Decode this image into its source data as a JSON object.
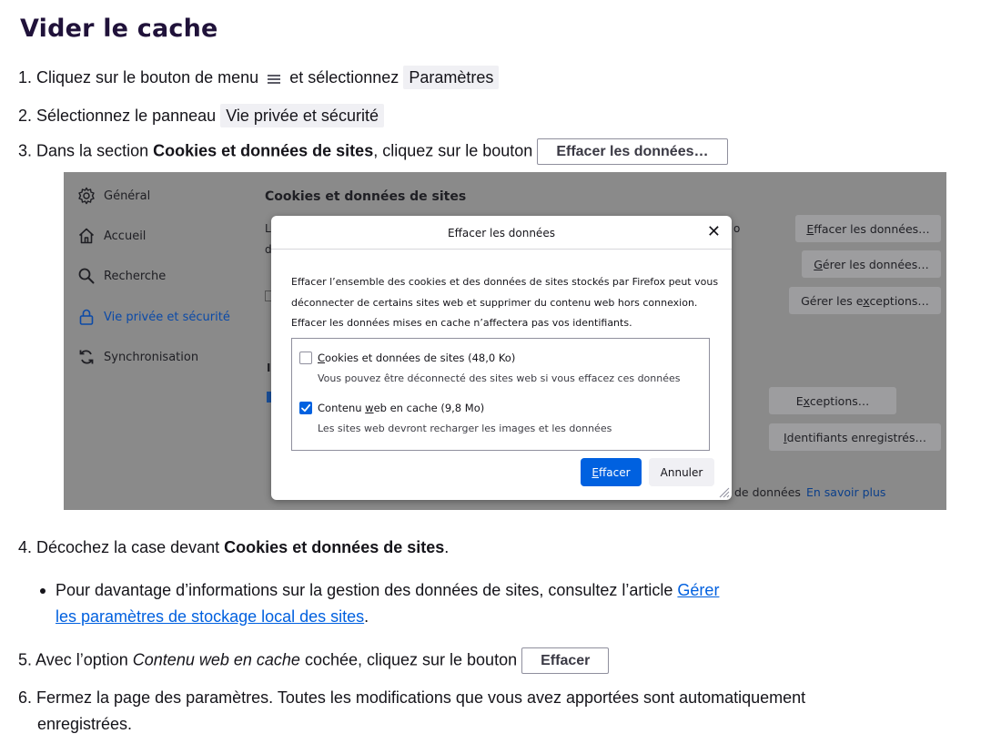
{
  "title": "Vider le cache",
  "steps": {
    "s1": {
      "num": "1.",
      "pre": "Cliquez sur le bouton de menu",
      "mid": "et sélectionnez",
      "chip": "Paramètres"
    },
    "s2": {
      "num": "2.",
      "pre": "Sélectionnez le panneau",
      "chip": "Vie privée et sécurité"
    },
    "s3": {
      "num": "3.",
      "pre": "Dans la section",
      "bold": "Cookies et données de sites",
      "post": ", cliquez sur le bouton",
      "btn": "Effacer les données…"
    },
    "s4": {
      "num": "4.",
      "pre": "Décochez la case devant",
      "bold": "Cookies et données de sites",
      "post": "."
    },
    "s5": {
      "num": "5.",
      "pre": "Avec l’option",
      "italic": "Contenu web en cache",
      "post": "cochée, cliquez sur le bouton",
      "btn": "Effacer"
    },
    "s6": {
      "num": "6.",
      "line1": "Fermez la page des paramètres. Toutes les modifications que vous avez apportées sont automatiquement",
      "line2": "enregistrées."
    }
  },
  "bullet": {
    "pre": "Pour davantage d’informations sur la gestion des données de sites, consultez l’article",
    "link1": "Gérer",
    "link2": "les paramètres de stockage local des sites",
    "post": "."
  },
  "screenshot": {
    "nav": [
      {
        "label": "Général",
        "icon": "gear-icon"
      },
      {
        "label": "Accueil",
        "icon": "home-icon"
      },
      {
        "label": "Recherche",
        "icon": "search-icon"
      },
      {
        "label": "Vie privée et sécurité",
        "icon": "lock-icon"
      },
      {
        "label": "Synchronisation",
        "icon": "sync-icon"
      }
    ],
    "heading": "Cookies et données de sites",
    "frag_l": "L",
    "frag_d": "d",
    "frag_o": "o",
    "frag_i": "I",
    "buttons": {
      "clear": {
        "ul": "E",
        "rest": "ffacer les données…"
      },
      "manage": {
        "ul": "G",
        "rest": "érer les données…"
      },
      "exceptions": {
        "pre": "Gérer les e",
        "ul": "x",
        "rest": "ceptions…"
      },
      "exc2": {
        "pre": "E",
        "ul": "x",
        "rest": "ceptions…"
      },
      "logins": {
        "ul": "I",
        "rest": "dentifiants enregistrés…"
      }
    },
    "footer_text": "de données",
    "footer_link": "En savoir plus",
    "dialog": {
      "title": "Effacer les données",
      "close": "✕",
      "text1": "Effacer l’ensemble des cookies et des données de sites stockés par Firefox peut vous",
      "text2": "déconnecter de certains sites web et supprimer du contenu web hors connexion.",
      "text3": "Effacer les données mises en cache n’affectera pas vos identifiants.",
      "opt1": {
        "ul": "C",
        "rest": "ookies et données de sites (48,0 Ko)",
        "sub": "Vous pouvez être déconnecté des sites web si vous effacez ces données"
      },
      "opt2": {
        "pre": "Contenu ",
        "ul": "w",
        "rest": "eb en cache (9,8 Mo)",
        "sub": "Les sites web devront recharger les images et les données"
      },
      "primary": {
        "ul": "E",
        "rest": "ffacer"
      },
      "secondary": "Annuler",
      "accent": "#0061e0"
    }
  }
}
